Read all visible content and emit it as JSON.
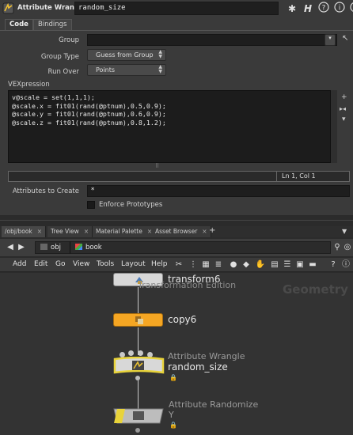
{
  "titlebar": {
    "node_type": "Attribute Wrangle",
    "node_name": "random_size",
    "icons": [
      "gear-icon",
      "houdini-h-icon",
      "help-icon",
      "info-icon",
      "pin-icon"
    ]
  },
  "tabs": [
    {
      "label": "Code",
      "active": true
    },
    {
      "label": "Bindings",
      "active": false
    }
  ],
  "params": {
    "group_label": "Group",
    "group_value": "",
    "group_type_label": "Group Type",
    "group_type_value": "Guess from Group",
    "run_over_label": "Run Over",
    "run_over_value": "Points",
    "vex_label": "VEXpression",
    "code": [
      "v@scale = set(1,1,1);",
      "@scale.x = fit01(rand(@ptnum),0.5,0.9);",
      "@scale.y = fit01(rand(@ptnum),0.6,0.9);",
      "@scale.z = fit01(rand(@ptnum),0.8,1.2);"
    ],
    "cursor_position": "Ln 1, Col 1",
    "attributes_to_create_label": "Attributes to Create",
    "attributes_to_create_value": "*",
    "enforce_prototypes_label": "Enforce Prototypes",
    "enforce_prototypes_checked": false
  },
  "network_tabs": [
    {
      "label": "/obj/book",
      "active": true
    },
    {
      "label": "Tree View",
      "active": false
    },
    {
      "label": "Material Palette",
      "active": false
    },
    {
      "label": "Asset Browser",
      "active": false
    }
  ],
  "path": {
    "level1": "obj",
    "level2": "book"
  },
  "network_menu": [
    "Add",
    "Edit",
    "Go",
    "View",
    "Tools",
    "Layout",
    "Help"
  ],
  "network": {
    "context_label": "Geometry",
    "nodes": [
      {
        "name": "transform6",
        "subtitle": "Transformation Edition",
        "color": "#d8d8d8"
      },
      {
        "name": "copy6",
        "subtitle": "",
        "color": "#f5a623"
      },
      {
        "name": "random_size",
        "type_label": "Attribute Wrangle",
        "color": "#d8d8d8",
        "accent": "#e8d33a"
      },
      {
        "name": "Attribute Randomize",
        "subtitle2": "Y",
        "color": "#d8d8d8",
        "accent": "#e8d33a"
      }
    ]
  },
  "colors": {
    "pane_bg": "#3a3a3a",
    "network_bg": "#333333",
    "copy_node": "#f5a623",
    "selected_node_outline": "#e8d33a"
  }
}
